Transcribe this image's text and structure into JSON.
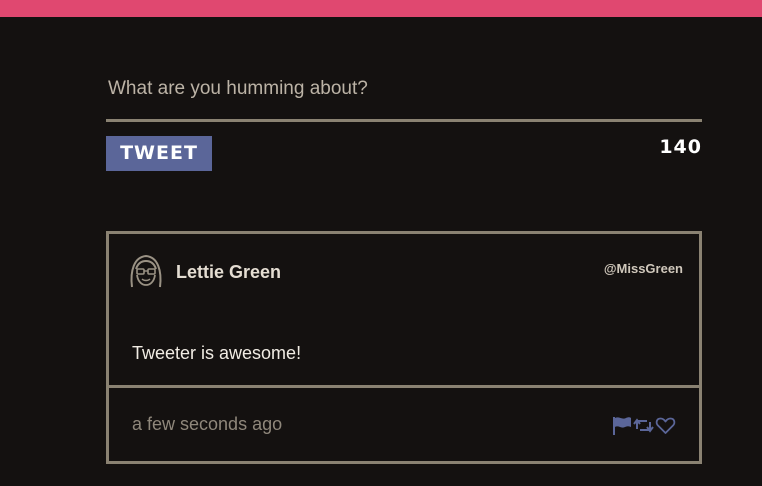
{
  "colors": {
    "accent_bar": "#e04870",
    "background": "#141110",
    "button": "#5b6699",
    "border": "#8a8272",
    "action_icon": "#5b6699"
  },
  "composer": {
    "placeholder": "What are you humming about?",
    "value": "",
    "tweet_button_label": "TWEET",
    "char_count": "140"
  },
  "tweet": {
    "user_name": "Lettie Green",
    "handle": "@MissGreen",
    "text": "Tweeter is awesome!",
    "timestamp": "a few seconds ago",
    "avatar_icon": "girl-with-glasses-avatar",
    "actions": [
      "flag-icon",
      "retweet-icon",
      "heart-icon"
    ]
  }
}
